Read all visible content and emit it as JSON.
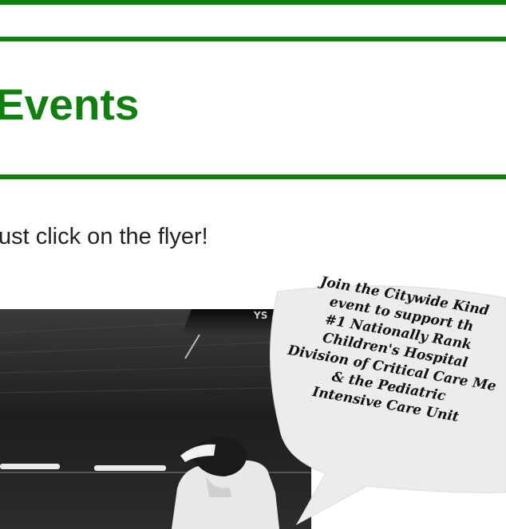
{
  "page": {
    "heading": "Events",
    "instruction": "ust click on the flyer!",
    "colors": {
      "accent": "#118011",
      "text": "#222222",
      "background": "#ffffff"
    }
  },
  "flyer": {
    "bubble_lines": [
      "Join the Citywide Kind",
      "event to support th",
      "#1 Nationally Rank",
      "Children's Hospital",
      "Division of Critical Care Me",
      "& the Pediatric",
      "Intensive Care Unit"
    ]
  }
}
